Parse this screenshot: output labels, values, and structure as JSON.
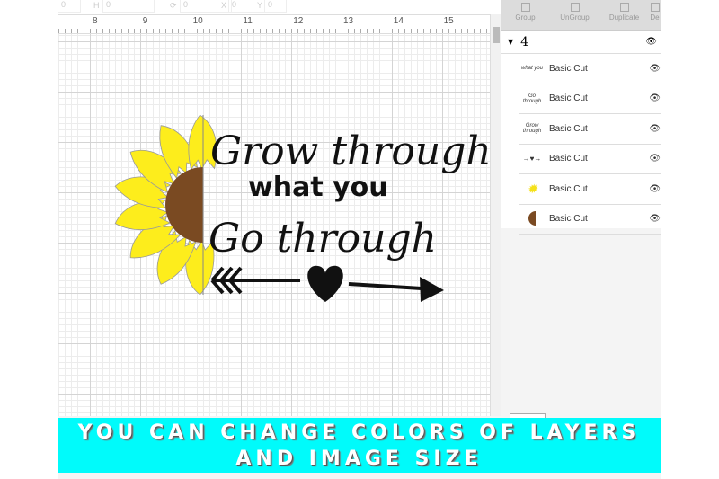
{
  "toolbar": {
    "w_value": "0",
    "h_label": "H",
    "h_value": "0",
    "rotate_value": "0",
    "x_label": "X",
    "x_value": "0",
    "y_label": "Y",
    "y_value": "0"
  },
  "ruler": {
    "ticks": [
      "8",
      "9",
      "10",
      "11",
      "12",
      "13",
      "14",
      "15"
    ]
  },
  "design": {
    "line1": "Grow through",
    "line2": "what you",
    "line3": "Go through",
    "colors": {
      "petal": "#fded1c",
      "center": "#7a4a22",
      "ink": "#111111"
    }
  },
  "panel": {
    "tools": [
      "Group",
      "UnGroup",
      "Duplicate",
      "De"
    ],
    "group_label": "4",
    "layers": [
      {
        "label": "Basic Cut",
        "thumb": "what you"
      },
      {
        "label": "Basic Cut",
        "thumb": "Go through"
      },
      {
        "label": "Basic Cut",
        "thumb": "Grow through"
      },
      {
        "label": "Basic Cut",
        "thumb": "arrow-heart"
      },
      {
        "label": "Basic Cut",
        "thumb": "petals"
      },
      {
        "label": "Basic Cut",
        "thumb": "center"
      }
    ]
  },
  "banner": {
    "line1": "YOU CAN CHANGE COLORS OF LAYERS",
    "line2": "AND IMAGE SIZE",
    "color": "#00fbfb"
  }
}
